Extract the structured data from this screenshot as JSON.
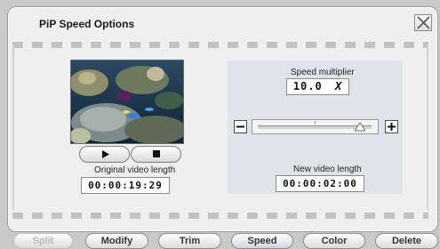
{
  "dialog": {
    "title": "PiP Speed Options",
    "close_icon": "close-icon"
  },
  "preview": {
    "image": "coral-reef-video-thumbnail",
    "play_icon": "play-icon",
    "stop_icon": "stop-icon",
    "original_length_label": "Original video length",
    "original_length_value": "00:00:19:29"
  },
  "speed": {
    "multiplier_label": "Speed multiplier",
    "multiplier_value": "10.0",
    "multiplier_unit": "X",
    "minus_icon": "minus-icon",
    "plus_icon": "plus-icon",
    "slider_fraction": 0.9,
    "new_length_label": "New video length",
    "new_length_value": "00:00:02:00"
  },
  "toolbar": {
    "tabs": [
      {
        "label": "Split",
        "enabled": false
      },
      {
        "label": "Modify",
        "enabled": true
      },
      {
        "label": "Trim",
        "enabled": true
      },
      {
        "label": "Speed",
        "enabled": true,
        "active": true
      },
      {
        "label": "Color",
        "enabled": true
      },
      {
        "label": "Delete",
        "enabled": true
      }
    ]
  }
}
